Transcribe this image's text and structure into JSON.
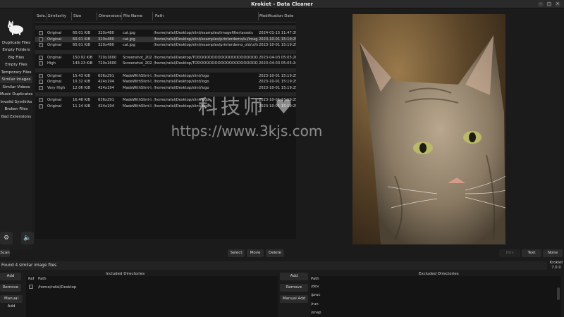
{
  "window": {
    "title": "Krokiet - Data Cleaner",
    "controls": [
      "minimize-icon",
      "maximize-icon",
      "close-icon"
    ]
  },
  "sidebar": {
    "items": [
      {
        "label": "Duplicate Files",
        "active": false
      },
      {
        "label": "Empty Folders",
        "active": false
      },
      {
        "label": "Big Files",
        "active": false
      },
      {
        "label": "Empty Files",
        "active": false
      },
      {
        "label": "Temporary Files",
        "active": false
      },
      {
        "label": "Similar Images",
        "active": true
      },
      {
        "label": "Similar Videos",
        "active": false
      },
      {
        "label": "Music Duplicates",
        "active": false
      },
      {
        "label": "Invalid Symlinks",
        "active": false
      },
      {
        "label": "Broken Files",
        "active": false
      },
      {
        "label": "Bad Extensions",
        "active": false
      }
    ],
    "bottom_icons": [
      "gear-icon",
      "sound-icon"
    ]
  },
  "table": {
    "columns": [
      "Sele...",
      "Similarity",
      "Size",
      "Dimensions",
      "File Name",
      "Path",
      "Modification Date"
    ],
    "groups": [
      [
        {
          "similarity": "Original",
          "size": "60.01 KiB",
          "dim": "320x480",
          "name": "cat.jpg",
          "path": "/home/rafal/Desktop/slint/examples/imagefilter/assets",
          "date": "2024-01-15 11:47:39",
          "selected": false
        },
        {
          "similarity": "Original",
          "size": "60.01 KiB",
          "dim": "320x480",
          "name": "cat.jpg",
          "path": "/home/rafal/Desktop/slint/examples/printerdemo/ui/images",
          "date": "2023-10-01 15:19:25",
          "selected": true
        },
        {
          "similarity": "Original",
          "size": "60.01 KiB",
          "dim": "320x480",
          "name": "cat.jpg",
          "path": "/home/rafal/Desktop/slint/examples/printerdemo_old/ui/im...",
          "date": "2023-10-01 15:19:25",
          "selected": false
        }
      ],
      [
        {
          "similarity": "Original",
          "size": "150.92 KiB",
          "dim": "720x1600",
          "name": "Screenshot_202...",
          "path": "/home/rafal/Desktop/TODOOOOOOOOOOOOOOOOOOOO/Pic...",
          "date": "2023-04-03 05:05:20",
          "selected": false
        },
        {
          "similarity": "High",
          "size": "143.23 KiB",
          "dim": "720x1600",
          "name": "Screenshot_202...",
          "path": "/home/rafal/Desktop/TODOOOOOOOOOOOOOOOOOOOO/Pic...",
          "date": "2023-04-03 05:05:24",
          "selected": false
        }
      ],
      [
        {
          "similarity": "Original",
          "size": "15.43 KiB",
          "dim": "636x291",
          "name": "MadeWithSlint-l...",
          "path": "/home/rafal/Desktop/slint/logo",
          "date": "2023-10-01 15:19:25",
          "selected": false
        },
        {
          "similarity": "Original",
          "size": "10.32 KiB",
          "dim": "424x194",
          "name": "MadeWithSlint-l...",
          "path": "/home/rafal/Desktop/slint/logo",
          "date": "2023-10-01 15:19:25",
          "selected": false
        },
        {
          "similarity": "Very High",
          "size": "12.06 KiB",
          "dim": "424x194",
          "name": "MadeWithSlint-l...",
          "path": "/home/rafal/Desktop/slint/logo",
          "date": "2023-10-01 15:19:25",
          "selected": false
        }
      ],
      [
        {
          "similarity": "Original",
          "size": "16.48 KiB",
          "dim": "636x291",
          "name": "MadeWithSlint-l...",
          "path": "/home/rafal/Desktop/slint/logo",
          "date": "2023-10-01 15:19:25",
          "selected": false
        },
        {
          "similarity": "Original",
          "size": "11.14 KiB",
          "dim": "424x194",
          "name": "MadeWithSlint-l...",
          "path": "/home/rafal/Desktop/slint/logo",
          "date": "2023-10-01 15:19:25",
          "selected": false
        }
      ]
    ]
  },
  "watermark": {
    "line1": "科技师 ♥",
    "line2": "https://www.3kjs.com"
  },
  "actions": {
    "scan": "Scan",
    "select": "Select",
    "move": "Move",
    "delete": "Delete"
  },
  "preview_toggle": {
    "dirs": "Dirs",
    "text": "Text",
    "none": "None"
  },
  "status": {
    "text": "Found 4 similar image files",
    "app": "Krokiet",
    "version": "7.0.0"
  },
  "included": {
    "title": "Included Directories",
    "add": "Add",
    "remove": "Remove",
    "manual_add": "Manual Add",
    "col_ref": "Ref",
    "col_path": "Path",
    "rows": [
      "/home/rafal/Desktop"
    ]
  },
  "excluded": {
    "title": "Excluded Directories",
    "add": "Add",
    "remove": "Remove",
    "manual_add": "Manual Add",
    "col_path": "Path",
    "rows": [
      "/dev",
      "/proc",
      "/run",
      "/snap"
    ]
  }
}
